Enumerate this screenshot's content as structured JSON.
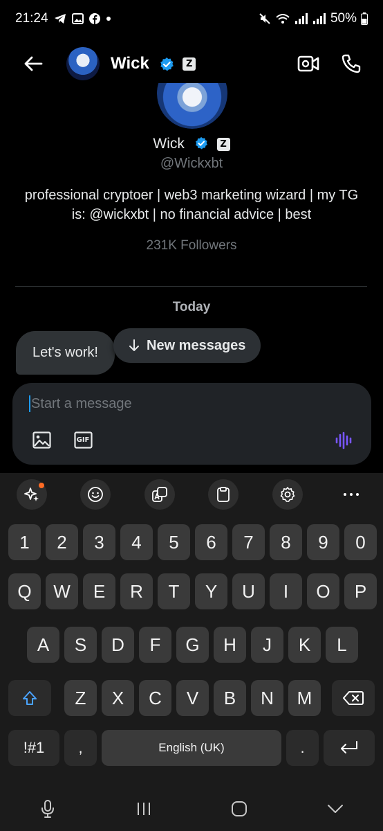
{
  "status_bar": {
    "time": "21:24",
    "battery": "50%"
  },
  "header": {
    "name": "Wick",
    "z_badge": "Z"
  },
  "profile": {
    "name": "Wick",
    "z_badge": "Z",
    "handle": "@Wickxbt",
    "bio": "professional cryptoer | web3 marketing wizard | my TG is: @wickxbt | no financial advice | best",
    "followers": "231K Followers"
  },
  "conversation": {
    "date_label": "Today",
    "messages": [
      {
        "text": "Let's work!"
      }
    ],
    "new_messages_label": "New messages"
  },
  "composer": {
    "placeholder": "Start a message",
    "gif_label": "GIF"
  },
  "keyboard": {
    "number_row": [
      "1",
      "2",
      "3",
      "4",
      "5",
      "6",
      "7",
      "8",
      "9",
      "0"
    ],
    "row1": [
      "Q",
      "W",
      "E",
      "R",
      "T",
      "Y",
      "U",
      "I",
      "O",
      "P"
    ],
    "row2": [
      "A",
      "S",
      "D",
      "F",
      "G",
      "H",
      "J",
      "K",
      "L"
    ],
    "row3": [
      "Z",
      "X",
      "C",
      "V",
      "B",
      "N",
      "M"
    ],
    "symbols_key": "!#1",
    "comma_key": ",",
    "space_label": "English (UK)",
    "period_key": "."
  },
  "colors": {
    "accent": "#1d9bf0",
    "background": "#000000",
    "voice_accent": "#7856ff"
  }
}
